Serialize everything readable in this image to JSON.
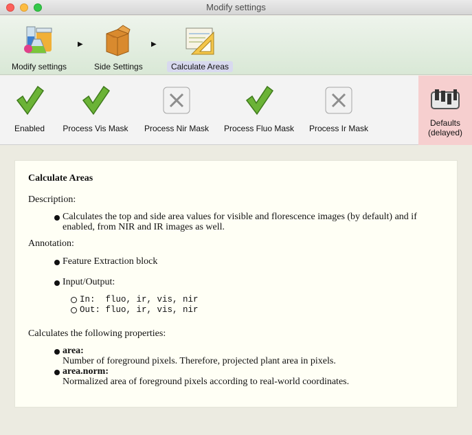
{
  "window": {
    "title": "Modify settings"
  },
  "breadcrumbs": [
    {
      "label": "Modify settings",
      "icon": "lab-glassware-icon"
    },
    {
      "label": "Side Settings",
      "icon": "package-box-icon"
    },
    {
      "label": "Calculate Areas",
      "icon": "area-ruler-icon",
      "active": true
    }
  ],
  "toolbar": {
    "items": [
      {
        "label": "Enabled",
        "state": "checked"
      },
      {
        "label": "Process Vis Mask",
        "state": "checked"
      },
      {
        "label": "Process Nir Mask",
        "state": "unchecked"
      },
      {
        "label": "Process Fluo Mask",
        "state": "checked"
      },
      {
        "label": "Process Ir Mask",
        "state": "unchecked"
      }
    ],
    "defaults_line1": "Defaults",
    "defaults_line2": "(delayed)"
  },
  "content": {
    "heading": "Calculate Areas",
    "description_label": "Description:",
    "description_line1": "Calculates the top and side area values for visible and florescence images (by default) and if",
    "description_line2": "enabled, from NIR and IR images as well.",
    "annotation_label": "Annotation:",
    "annotation_item1": "Feature Extraction block",
    "annotation_item2": "Input/Output:",
    "io_in": "In:  fluo, ir, vis, nir",
    "io_out": "Out: fluo, ir, vis, nir",
    "properties_label": "Calculates the following properties:",
    "prop1_name": "area:",
    "prop1_desc": "Number of foreground pixels. Therefore, projected plant area in pixels.",
    "prop2_name": "area.norm:",
    "prop2_desc": "Normalized area of foreground pixels according to real-world coordinates."
  },
  "colors": {
    "check_green": "#5fa82e",
    "defaults_bg": "#f6cfcf",
    "active_crumb_bg": "#d8d9ef"
  }
}
